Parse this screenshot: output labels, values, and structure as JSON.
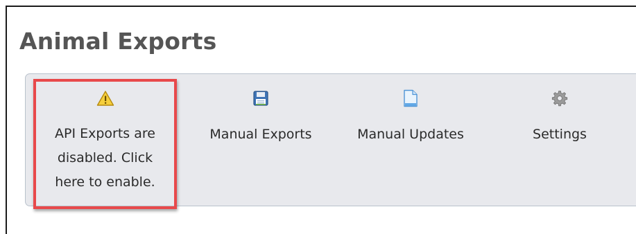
{
  "page": {
    "title": "Animal Exports"
  },
  "toolbar": {
    "items": [
      {
        "label": "API Exports are\ndisabled. Click\nhere to enable.",
        "icon": "warning-icon"
      },
      {
        "label": "Manual Exports",
        "icon": "floppy-disk-icon"
      },
      {
        "label": "Manual Updates",
        "icon": "document-icon"
      },
      {
        "label": "Settings",
        "icon": "gear-icon"
      }
    ]
  },
  "colors": {
    "highlight": "#e8494b",
    "toolbar_bg": "#e8e9ed",
    "title": "#555555",
    "warning": "#f2c230",
    "floppy": "#4f86c6",
    "document": "#5aa0dc",
    "gear": "#8a8a8a"
  }
}
